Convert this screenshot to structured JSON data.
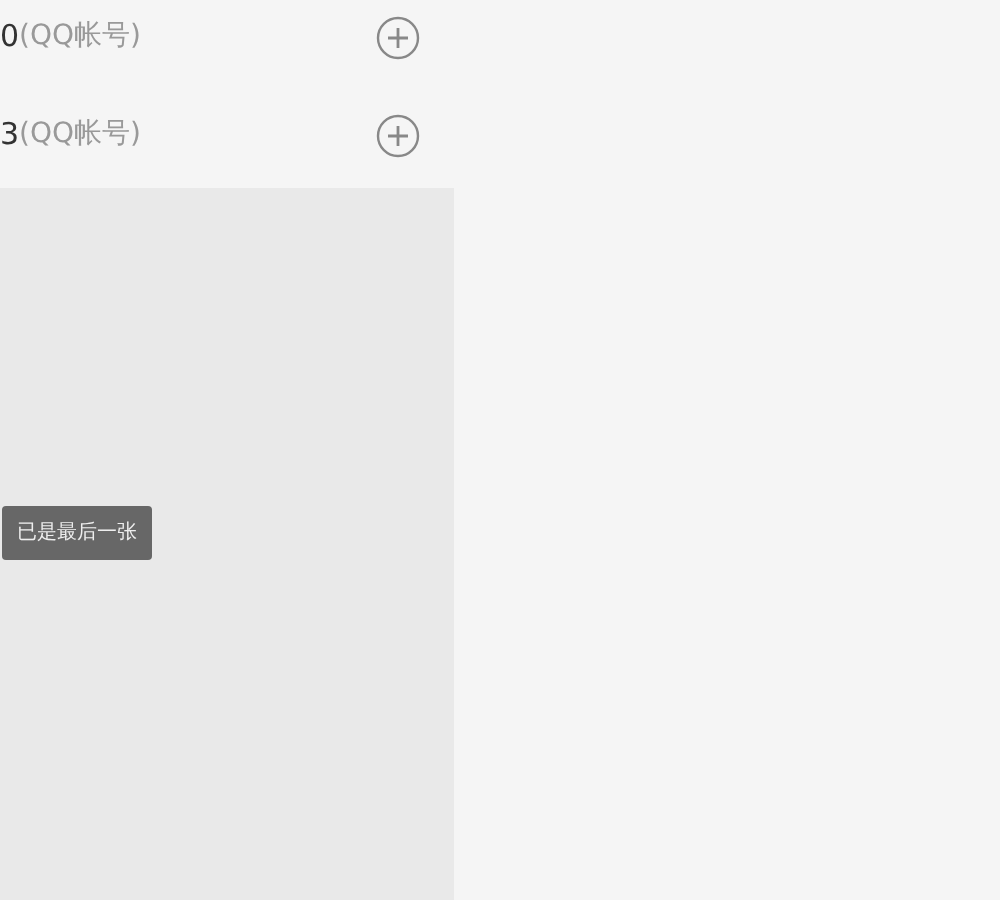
{
  "contacts": [
    {
      "number": "0",
      "type": "(QQ帐号)"
    },
    {
      "number": "3",
      "type": "(QQ帐号)"
    }
  ],
  "toast": {
    "text": "已是最后一张"
  }
}
